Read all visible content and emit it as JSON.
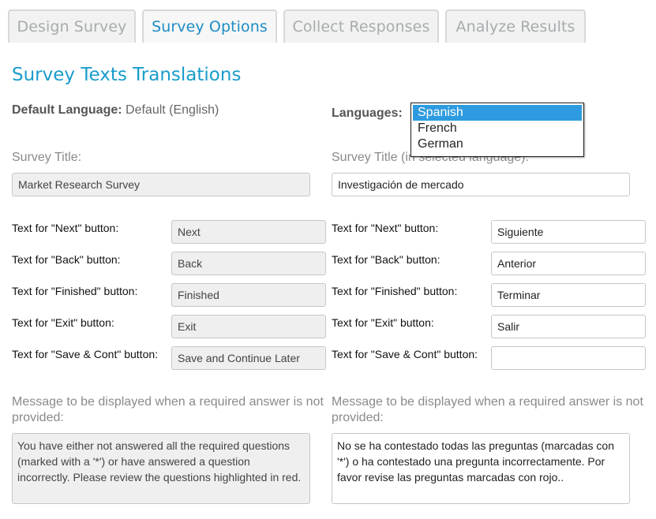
{
  "tabs": [
    {
      "label": "Design Survey"
    },
    {
      "label": "Survey Options"
    },
    {
      "label": "Collect Responses"
    },
    {
      "label": "Analyze Results"
    }
  ],
  "page_title": "Survey Texts Translations",
  "default_language": {
    "label": "Default Language:",
    "value": "Default (English)"
  },
  "languages": {
    "label": "Languages:",
    "options": [
      "Spanish",
      "French",
      "German"
    ],
    "selected": "Spanish"
  },
  "survey_title": {
    "default_label": "Survey Title:",
    "translated_label": "Survey Title (in selected language):",
    "default_value": "Market Research Survey",
    "translated_value": "Investigación de mercado"
  },
  "buttons": [
    {
      "label": "Text for \"Next\" button:",
      "default": "Next",
      "translated": "Siguiente"
    },
    {
      "label": "Text for \"Back\" button:",
      "default": "Back",
      "translated": "Anterior"
    },
    {
      "label": "Text for \"Finished\" button:",
      "default": "Finished",
      "translated": "Terminar"
    },
    {
      "label": "Text for \"Exit\" button:",
      "default": "Exit",
      "translated": "Salir"
    },
    {
      "label": "Text for \"Save & Cont\" button:",
      "default": "Save and Continue Later",
      "translated": ""
    }
  ],
  "required_message": {
    "label": "Message to be displayed when a required answer is not provided:",
    "default": "You have either not answered all the required questions (marked with a '*') or have answered a question incorrectly. Please review the questions highlighted in red.",
    "translated": "No se ha contestado todas las preguntas  (marcadas con  '*') o ha contestado una pregunta incorrectamente. Por favor revise las preguntas marcadas con rojo.."
  }
}
